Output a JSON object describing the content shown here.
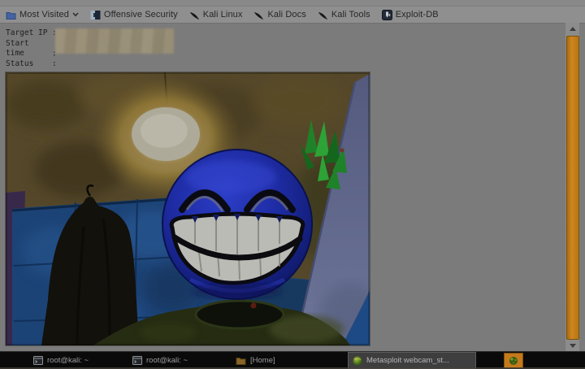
{
  "bookmarks_bar": {
    "items": [
      {
        "label": "Most Visited",
        "icon": "folder-blue",
        "has_dropdown": true
      },
      {
        "label": "Offensive Security",
        "icon": "offsec-logo"
      },
      {
        "label": "Kali Linux",
        "icon": "kali-dragon"
      },
      {
        "label": "Kali Docs",
        "icon": "kali-dragon"
      },
      {
        "label": "Kali Tools",
        "icon": "kali-dragon"
      },
      {
        "label": "Exploit-DB",
        "icon": "exploit-db-logo"
      }
    ]
  },
  "page": {
    "status_block": {
      "rows": [
        {
          "label": "Target IP",
          "colon": ":"
        },
        {
          "label": "Start time",
          "colon": ":"
        },
        {
          "label": "Status",
          "colon": ":"
        }
      ],
      "values_redacted": true
    },
    "webcam_image": {
      "subject": "person with blue grinning smiley emoji covering face",
      "setting": "blue tiled wall, ceiling light, hanging dark coat, green plant, open lavender door"
    }
  },
  "scrollbar": {
    "orientation": "vertical",
    "thumb_color": "#c0791c"
  },
  "taskbar": {
    "items": [
      {
        "label": "root@kali: ~",
        "icon": "terminal",
        "active": false
      },
      {
        "label": "root@kali: ~",
        "icon": "terminal",
        "active": false
      },
      {
        "label": "[Home]",
        "icon": "folder",
        "active": false
      },
      {
        "label": "Metasploit webcam_st...",
        "icon": "browser-globe",
        "active": true
      }
    ],
    "tray_icon": "orange-app-icon"
  },
  "colors": {
    "toolbar_bg": "#8f8f8f",
    "page_bg": "#7b7b7b",
    "taskbar_bg": "#0a0a0a",
    "active_task_bg": "#3e3e3e",
    "smiley_blue": "#1e2ca4"
  }
}
